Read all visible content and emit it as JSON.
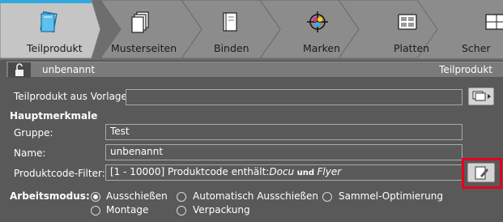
{
  "tabs": [
    {
      "label": "Teilprodukt",
      "icon": "teilprodukt-icon",
      "active": true
    },
    {
      "label": "Musterseiten",
      "icon": "musterseiten-icon",
      "active": false
    },
    {
      "label": "Binden",
      "icon": "binden-icon",
      "active": false
    },
    {
      "label": "Marken",
      "icon": "marken-icon",
      "active": false
    },
    {
      "label": "Platten",
      "icon": "platten-icon",
      "active": false
    },
    {
      "label": "Scher",
      "icon": "schema-icon",
      "active": false
    }
  ],
  "header": {
    "name": "unbenannt",
    "right": "Teilprodukt",
    "lock_icon": "lock-open-icon"
  },
  "vorlage": {
    "label": "Teilprodukt aus Vorlage:",
    "value": "",
    "button_icon": "template-menu-icon"
  },
  "hauptmerkmale": {
    "title": "Hauptmerkmale"
  },
  "gruppe": {
    "label": "Gruppe:",
    "value": "Test"
  },
  "name": {
    "label": "Name:",
    "value": "unbenannt"
  },
  "filter": {
    "label": "Produktcode-Filter:",
    "prefix": "[1 - 10000] Produktcode enthält:",
    "term1": "Docu",
    "joiner": " und ",
    "term2": "Flyer",
    "button_icon": "edit-filter-icon"
  },
  "arbeitsmodus": {
    "label": "Arbeitsmodus:",
    "options": [
      {
        "label": "Ausschießen",
        "checked": true
      },
      {
        "label": "Automatisch Ausschießen",
        "checked": false
      },
      {
        "label": "Sammel-Optimierung",
        "checked": false
      },
      {
        "label": "Montage",
        "checked": false
      },
      {
        "label": "Verpackung",
        "checked": false
      }
    ]
  },
  "colors": {
    "accent_line": "#2fa9e0",
    "highlight": "#e4001b",
    "background": "#595959"
  }
}
